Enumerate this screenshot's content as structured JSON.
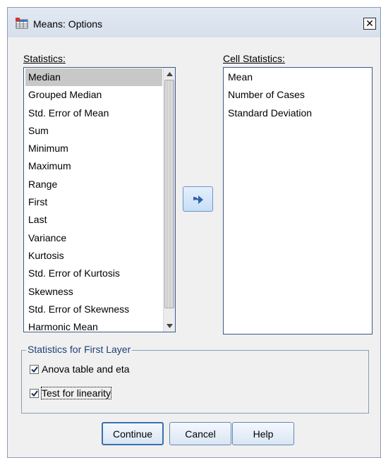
{
  "window": {
    "title": "Means: Options",
    "close_glyph": "✕"
  },
  "statistics": {
    "label": "Statistics:",
    "selected_index": 0,
    "items": [
      "Median",
      "Grouped Median",
      "Std. Error of Mean",
      "Sum",
      "Minimum",
      "Maximum",
      "Range",
      "First",
      "Last",
      "Variance",
      "Kurtosis",
      "Std. Error of Kurtosis",
      "Skewness",
      "Std. Error of Skewness",
      "Harmonic Mean"
    ]
  },
  "cell_statistics": {
    "label": "Cell Statistics:",
    "items": [
      "Mean",
      "Number of Cases",
      "Standard Deviation"
    ]
  },
  "move_button": {
    "icon": "right-arrow-icon"
  },
  "first_layer": {
    "legend": "Statistics for First Layer",
    "anova": {
      "label": "Anova table and eta",
      "checked": true
    },
    "linearity": {
      "label": "Test for linearity",
      "checked": true
    }
  },
  "buttons": {
    "continue": "Continue",
    "cancel": "Cancel",
    "help": "Help"
  },
  "colors": {
    "accent": "#3a6fb0",
    "selection": "#c8c8c8",
    "window_border": "#8d9cb3"
  }
}
